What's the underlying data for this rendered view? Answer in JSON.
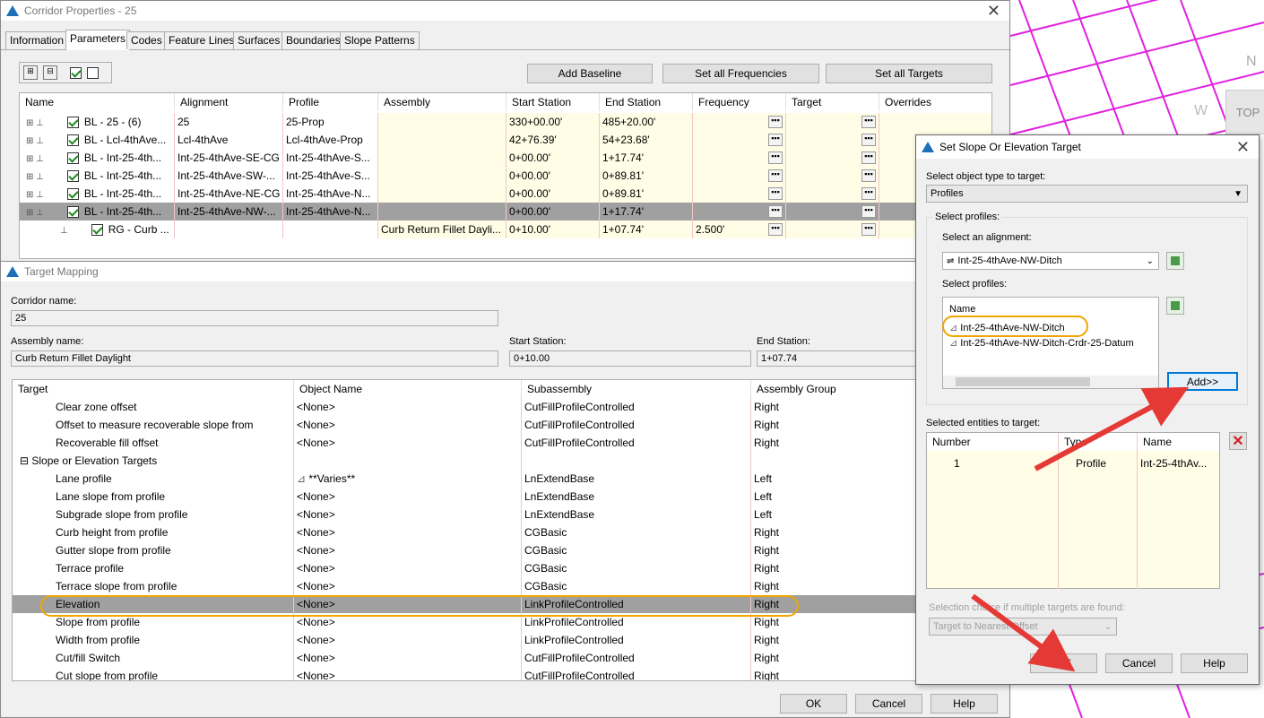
{
  "corridor_window": {
    "title": "Corridor Properties - 25",
    "tabs": [
      "Information",
      "Parameters",
      "Codes",
      "Feature Lines",
      "Surfaces",
      "Boundaries",
      "Slope Patterns"
    ],
    "active_tab": "Parameters",
    "buttons": {
      "add_baseline": "Add Baseline",
      "set_frequencies": "Set all Frequencies",
      "set_targets": "Set all Targets"
    },
    "columns": [
      "Name",
      "Alignment",
      "Profile",
      "Assembly",
      "Start Station",
      "End Station",
      "Frequency",
      "Target",
      "Overrides"
    ],
    "rows": [
      {
        "name": "BL - 25 - (6)",
        "alignment": "25",
        "profile": "25-Prop",
        "assembly": "",
        "start": "330+00.00'",
        "end": "485+20.00'",
        "freq": ""
      },
      {
        "name": "BL - Lcl-4thAve...",
        "alignment": "Lcl-4thAve",
        "profile": "Lcl-4thAve-Prop",
        "assembly": "",
        "start": "42+76.39'",
        "end": "54+23.68'",
        "freq": ""
      },
      {
        "name": "BL - Int-25-4th...",
        "alignment": "Int-25-4thAve-SE-CG",
        "profile": "Int-25-4thAve-S...",
        "assembly": "",
        "start": "0+00.00'",
        "end": "1+17.74'",
        "freq": ""
      },
      {
        "name": "BL - Int-25-4th...",
        "alignment": "Int-25-4thAve-SW-...",
        "profile": "Int-25-4thAve-S...",
        "assembly": "",
        "start": "0+00.00'",
        "end": "0+89.81'",
        "freq": ""
      },
      {
        "name": "BL - Int-25-4th...",
        "alignment": "Int-25-4thAve-NE-CG",
        "profile": "Int-25-4thAve-N...",
        "assembly": "",
        "start": "0+00.00'",
        "end": "0+89.81'",
        "freq": ""
      },
      {
        "name": "BL - Int-25-4th...",
        "alignment": "Int-25-4thAve-NW-...",
        "profile": "Int-25-4thAve-N...",
        "assembly": "",
        "start": "0+00.00'",
        "end": "1+17.74'",
        "freq": ""
      },
      {
        "name": "RG - Curb ...",
        "alignment": "",
        "profile": "",
        "assembly": "Curb Return Fillet Dayli...",
        "start": "0+10.00'",
        "end": "1+07.74'",
        "freq": "2.500'"
      }
    ]
  },
  "target_mapping": {
    "title": "Target Mapping",
    "corridor_name_label": "Corridor name:",
    "corridor_name": "25",
    "assembly_name_label": "Assembly name:",
    "assembly_name": "Curb Return Fillet Daylight",
    "start_station_label": "Start Station:",
    "start_station": "0+10.00",
    "end_station_label": "End Station:",
    "end_station": "1+07.74",
    "columns": [
      "Target",
      "Object Name",
      "Subassembly",
      "Assembly Group"
    ],
    "rows": [
      {
        "target": "Clear zone offset",
        "object": "<None>",
        "sub": "CutFillProfileControlled",
        "group": "Right",
        "level": 2
      },
      {
        "target": "Offset to measure recoverable slope from",
        "object": "<None>",
        "sub": "CutFillProfileControlled",
        "group": "Right",
        "level": 2
      },
      {
        "target": "Recoverable fill offset",
        "object": "<None>",
        "sub": "CutFillProfileControlled",
        "group": "Right",
        "level": 2
      },
      {
        "target": "Slope or Elevation Targets",
        "object": "",
        "sub": "",
        "group": "",
        "level": 1
      },
      {
        "target": "Lane profile",
        "object": "**Varies**",
        "sub": "LnExtendBase",
        "group": "Left",
        "level": 2
      },
      {
        "target": "Lane slope from profile",
        "object": "<None>",
        "sub": "LnExtendBase",
        "group": "Left",
        "level": 2
      },
      {
        "target": "Subgrade slope from profile",
        "object": "<None>",
        "sub": "LnExtendBase",
        "group": "Left",
        "level": 2
      },
      {
        "target": "Curb height from profile",
        "object": "<None>",
        "sub": "CGBasic",
        "group": "Right",
        "level": 2
      },
      {
        "target": "Gutter slope from profile",
        "object": "<None>",
        "sub": "CGBasic",
        "group": "Right",
        "level": 2
      },
      {
        "target": "Terrace profile",
        "object": "<None>",
        "sub": "CGBasic",
        "group": "Right",
        "level": 2
      },
      {
        "target": "Terrace slope from profile",
        "object": "<None>",
        "sub": "CGBasic",
        "group": "Right",
        "level": 2
      },
      {
        "target": "Elevation",
        "object": "<None>",
        "sub": "LinkProfileControlled",
        "group": "Right",
        "level": 2
      },
      {
        "target": "Slope from profile",
        "object": "<None>",
        "sub": "LinkProfileControlled",
        "group": "Right",
        "level": 2
      },
      {
        "target": "Width from profile",
        "object": "<None>",
        "sub": "LinkProfileControlled",
        "group": "Right",
        "level": 2
      },
      {
        "target": "Cut/fill Switch",
        "object": "<None>",
        "sub": "CutFillProfileControlled",
        "group": "Right",
        "level": 2
      },
      {
        "target": "Cut slope from profile",
        "object": "<None>",
        "sub": "CutFillProfileControlled",
        "group": "Right",
        "level": 2
      }
    ],
    "buttons": {
      "ok": "OK",
      "cancel": "Cancel",
      "help": "Help"
    }
  },
  "slope_dialog": {
    "title": "Set Slope Or Elevation Target",
    "object_type_label": "Select object type to target:",
    "object_type": "Profiles",
    "profiles_group": "Select profiles:",
    "alignment_label": "Select an alignment:",
    "alignment": "Int-25-4thAve-NW-Ditch",
    "profiles_label": "Select profiles:",
    "list_header": "Name",
    "profiles": [
      "Int-25-4thAve-NW-Ditch",
      "Int-25-4thAve-NW-Ditch-Crdr-25-Datum"
    ],
    "add_button": "Add>>",
    "selected_label": "Selected entities to target:",
    "sel_columns": [
      "Number",
      "Type",
      "Name"
    ],
    "selected": [
      {
        "number": "1",
        "type": "Profile",
        "name": "Int-25-4thAv..."
      }
    ],
    "choice_label": "Selection choice if multiple targets are found:",
    "choice": "Target to Nearest Offset",
    "buttons": {
      "ok": "OK",
      "cancel": "Cancel",
      "help": "Help"
    }
  },
  "background": {
    "labels": [
      "N",
      "W",
      "TOP"
    ]
  }
}
